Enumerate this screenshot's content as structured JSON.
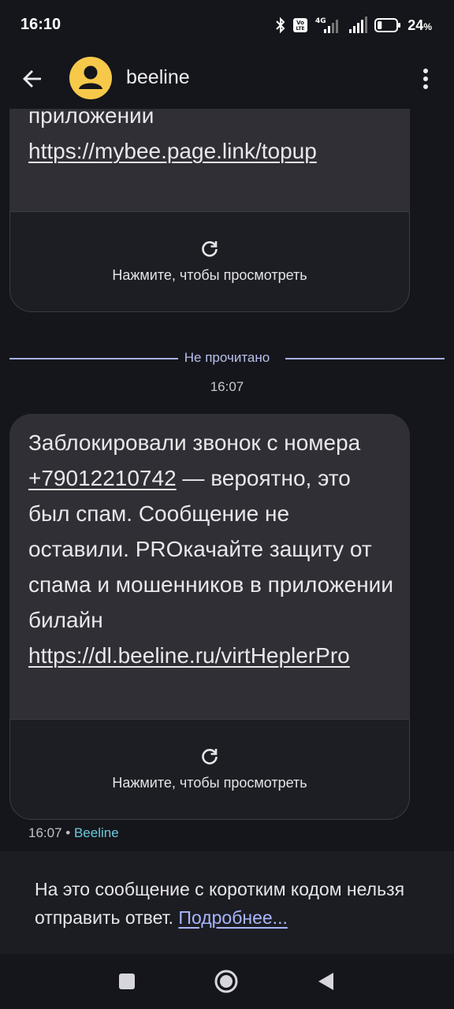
{
  "status_bar": {
    "time": "16:10",
    "network_label": "4G",
    "battery_percent": "24",
    "battery_suffix": "%",
    "battery_level": 0.24
  },
  "app_bar": {
    "contact_name": "beeline"
  },
  "messages": [
    {
      "lines": [
        "приложении",
        "https://mybee.page.link/topup"
      ],
      "preview_label": "Нажмите, чтобы просмотреть"
    },
    {
      "text_before": "Заблокировали звонок с номера ",
      "phone": "+79012210742",
      "text_after": " — вероятно, это был спам. Сообщение не оставили. PROкачайте защиту от спама и мошенников в приложении билайн ",
      "link": "https://dl.beeline.ru/virtHeplerPro",
      "preview_label": "Нажмите, чтобы просмотреть"
    }
  ],
  "divider": {
    "label": "Не прочитано",
    "time": "16:07"
  },
  "message_meta": {
    "time": "16:07",
    "separator": "•",
    "sender": "Beeline"
  },
  "notice": {
    "text": "На это сообщение с коротким кодом нельзя отправить ответ. ",
    "link": "Подробнее..."
  },
  "colors": {
    "background": "#15161b",
    "bubble": "#2f2f35",
    "accent_link": "#a9b6ff",
    "sender": "#6cc9dc",
    "avatar": "#f6c94a"
  }
}
